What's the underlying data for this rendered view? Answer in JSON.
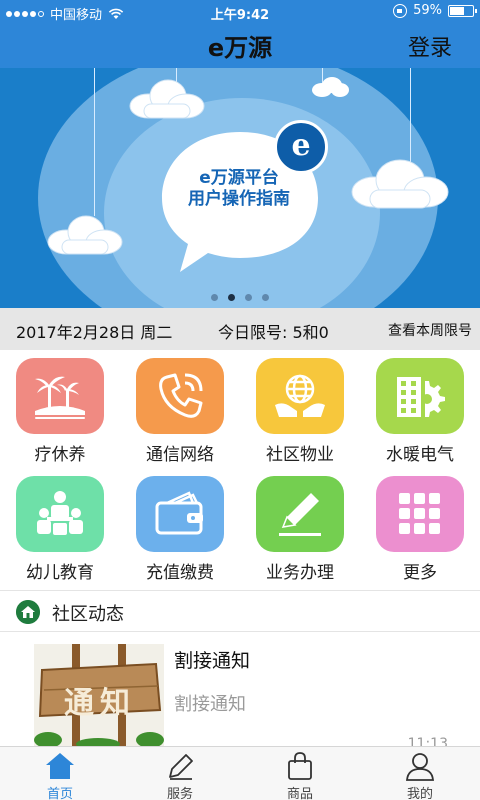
{
  "status_bar": {
    "carrier": "中国移动",
    "time": "上午9:42",
    "battery": "59%"
  },
  "nav": {
    "title": "e万源",
    "login_label": "登录"
  },
  "banner": {
    "badge": "e",
    "headline_line1": "e万源平台",
    "headline_line2": "用户操作指南",
    "page_count": 4,
    "active_page": 2
  },
  "date_row": {
    "date": "2017年2月28日 周二",
    "limit": "今日限号: 5和0",
    "week_link": "查看本周限号"
  },
  "services": [
    {
      "label": "疗休养",
      "icon": "palm-island-icon",
      "color": "#f08a82"
    },
    {
      "label": "通信网络",
      "icon": "phone-icon",
      "color": "#f59a4c"
    },
    {
      "label": "社区物业",
      "icon": "globe-hands-icon",
      "color": "#f7c73c"
    },
    {
      "label": "水暖电气",
      "icon": "building-gear-icon",
      "color": "#a6d84c"
    },
    {
      "label": "幼儿教育",
      "icon": "classroom-icon",
      "color": "#6ee0a8"
    },
    {
      "label": "充值缴费",
      "icon": "wallet-icon",
      "color": "#6cb0ec"
    },
    {
      "label": "业务办理",
      "icon": "pencil-icon",
      "color": "#74cf50"
    },
    {
      "label": "更多",
      "icon": "grid-icon",
      "color": "#ec8fcf"
    }
  ],
  "community": {
    "title": "社区动态",
    "news": [
      {
        "title": "割接通知",
        "summary": "割接通知",
        "time": "11:13",
        "thumb_text": "通知"
      }
    ]
  },
  "tabbar": {
    "items": [
      {
        "label": "首页",
        "icon": "home-icon",
        "active": true
      },
      {
        "label": "服务",
        "icon": "pen-icon",
        "active": false
      },
      {
        "label": "商品",
        "icon": "shopping-bag-icon",
        "active": false
      },
      {
        "label": "我的",
        "icon": "user-icon",
        "active": false
      }
    ]
  },
  "colors": {
    "nav_bg": "#2d86d8",
    "banner_bg": "#1a7ec9",
    "accent": "#2d86d8"
  }
}
